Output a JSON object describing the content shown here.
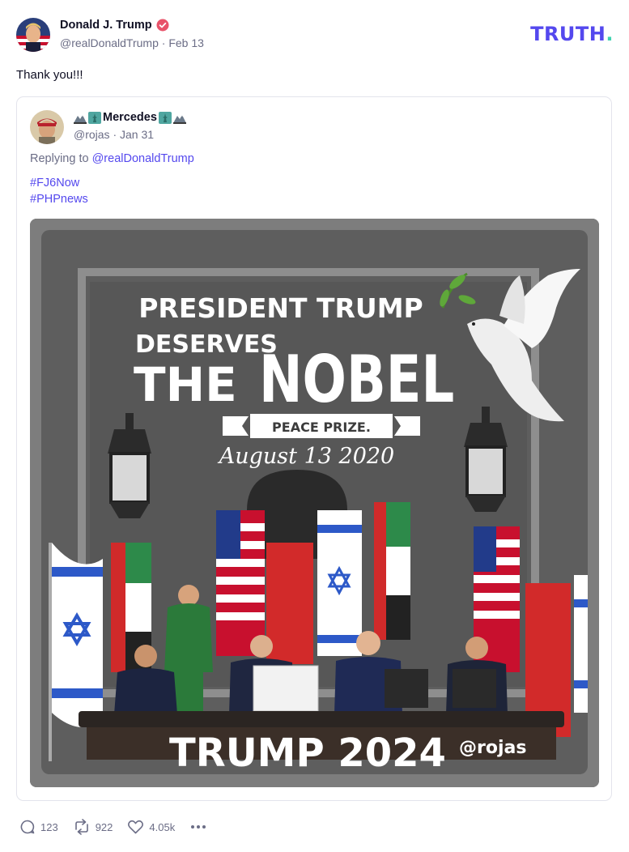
{
  "post": {
    "author_name": "Donald J. Trump",
    "author_handle": "@realDonaldTrump",
    "date": "Feb 13",
    "text": "Thank you!!!"
  },
  "brand": {
    "logo_text": "TRUTH",
    "logo_dot": ".",
    "accent": "#5448ee",
    "dot_color": "#3fd3b0"
  },
  "quote": {
    "author_name": "Mercedes",
    "author_handle": "@rojas",
    "date": "Jan 31",
    "replying_prefix": "Replying to",
    "replying_to": "@realDonaldTrump",
    "hashtags": [
      "#FJ6Now",
      "#PHPnews"
    ]
  },
  "image": {
    "line1": "PRESIDENT TRUMP",
    "line2a": "DESERVES",
    "line2b": "THE",
    "line2c": "NOBEL",
    "ribbon": "PEACE PRIZE.",
    "date_script": "August 13 2020",
    "footer_big": "TRUMP 2024",
    "footer_handle": "@rojas"
  },
  "actions": {
    "replies": "123",
    "retruths": "922",
    "likes": "4.05k"
  }
}
